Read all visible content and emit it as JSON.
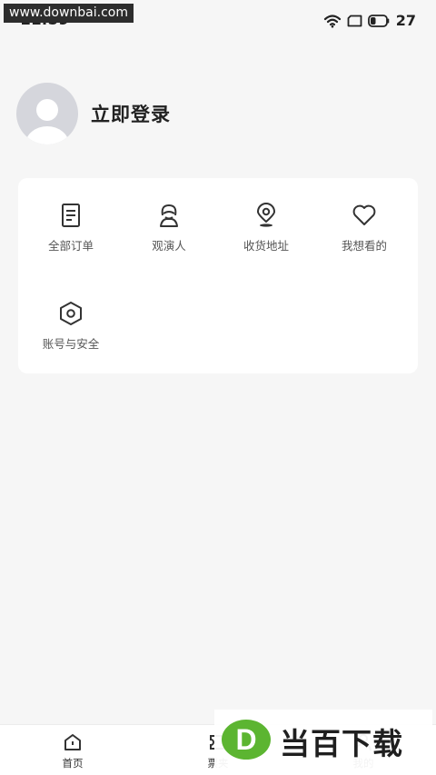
{
  "status_bar": {
    "time": "11:59",
    "battery": "27",
    "overlay_label": "www.downbai.com"
  },
  "profile": {
    "login_label": "立即登录"
  },
  "menu": {
    "items": [
      {
        "label": "全部订单",
        "icon": "document-icon"
      },
      {
        "label": "观演人",
        "icon": "person-icon"
      },
      {
        "label": "收货地址",
        "icon": "location-pin-icon"
      },
      {
        "label": "我想看的",
        "icon": "heart-icon"
      },
      {
        "label": "账号与安全",
        "icon": "hexagon-shield-icon"
      }
    ]
  },
  "tabbar": {
    "tabs": [
      {
        "label": "首页",
        "icon": "home-icon"
      },
      {
        "label": "票夹",
        "icon": "ticket-icon"
      },
      {
        "label": "我的",
        "icon": "user-icon"
      }
    ]
  },
  "watermark": {
    "text": "当百下载",
    "logo_letter": "D",
    "colors": {
      "green": "#5cb531",
      "dark": "#1f1f1f"
    }
  }
}
